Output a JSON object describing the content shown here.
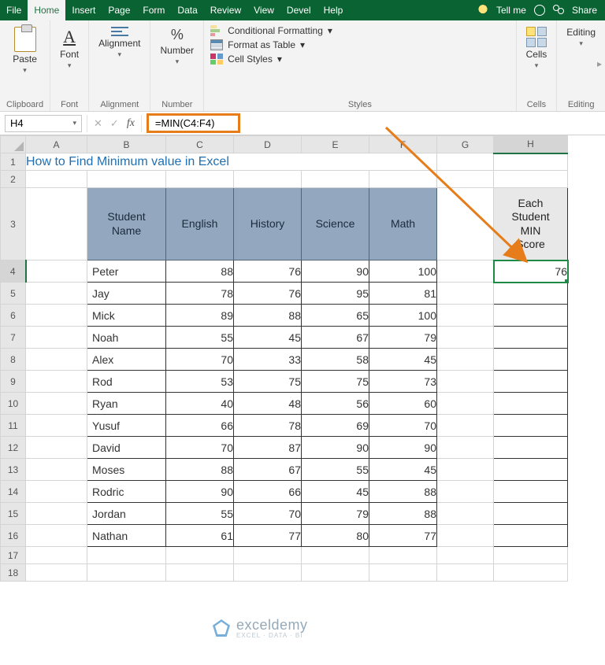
{
  "tabs": {
    "file": "File",
    "home": "Home",
    "insert": "Insert",
    "page": "Page",
    "form": "Form",
    "data": "Data",
    "review": "Review",
    "view": "View",
    "devel": "Devel",
    "help": "Help",
    "tellme": "Tell me",
    "share": "Share"
  },
  "ribbon": {
    "clipboard": {
      "button": "Paste",
      "label": "Clipboard"
    },
    "font": {
      "button": "Font",
      "label": "Font",
      "glyph": "A"
    },
    "alignment": {
      "button": "Alignment",
      "label": "Alignment"
    },
    "number": {
      "button": "Number",
      "label": "Number",
      "glyph": "%"
    },
    "styles": {
      "cond": "Conditional Formatting",
      "fat": "Format as Table",
      "cs": "Cell Styles",
      "label": "Styles"
    },
    "cells": {
      "button": "Cells",
      "label": "Cells"
    },
    "editing": {
      "button": "Editing",
      "label": "Editing"
    }
  },
  "formula_bar": {
    "name_box": "H4",
    "formula": "=MIN(C4:F4)",
    "fx": "fx"
  },
  "columns": [
    "A",
    "B",
    "C",
    "D",
    "E",
    "F",
    "G",
    "H"
  ],
  "sheet": {
    "title": "How to Find Minimum value in Excel",
    "headers": {
      "name": "Student Name",
      "english": "English",
      "history": "History",
      "science": "Science",
      "math": "Math",
      "min": "Each Student MIN Score"
    },
    "rows": [
      {
        "name": "Peter",
        "english": 88,
        "history": 76,
        "science": 90,
        "math": 100,
        "min": 76
      },
      {
        "name": "Jay",
        "english": 78,
        "history": 76,
        "science": 95,
        "math": 81
      },
      {
        "name": "Mick",
        "english": 89,
        "history": 88,
        "science": 65,
        "math": 100
      },
      {
        "name": "Noah",
        "english": 55,
        "history": 45,
        "science": 67,
        "math": 79
      },
      {
        "name": "Alex",
        "english": 70,
        "history": 33,
        "science": 58,
        "math": 45
      },
      {
        "name": "Rod",
        "english": 53,
        "history": 75,
        "science": 75,
        "math": 73
      },
      {
        "name": "Ryan",
        "english": 40,
        "history": 48,
        "science": 56,
        "math": 60
      },
      {
        "name": "Yusuf",
        "english": 66,
        "history": 78,
        "science": 69,
        "math": 70
      },
      {
        "name": "David",
        "english": 70,
        "history": 87,
        "science": 90,
        "math": 90
      },
      {
        "name": "Moses",
        "english": 88,
        "history": 67,
        "science": 55,
        "math": 45
      },
      {
        "name": "Rodric",
        "english": 90,
        "history": 66,
        "science": 45,
        "math": 88
      },
      {
        "name": "Jordan",
        "english": 55,
        "history": 70,
        "science": 79,
        "math": 88
      },
      {
        "name": "Nathan",
        "english": 61,
        "history": 77,
        "science": 80,
        "math": 77
      }
    ]
  },
  "watermark": {
    "text": "exceldemy",
    "sub": "EXCEL · DATA · BI"
  },
  "caret": "▾",
  "rcaret": "▸",
  "check": "✓",
  "cross": "✕"
}
